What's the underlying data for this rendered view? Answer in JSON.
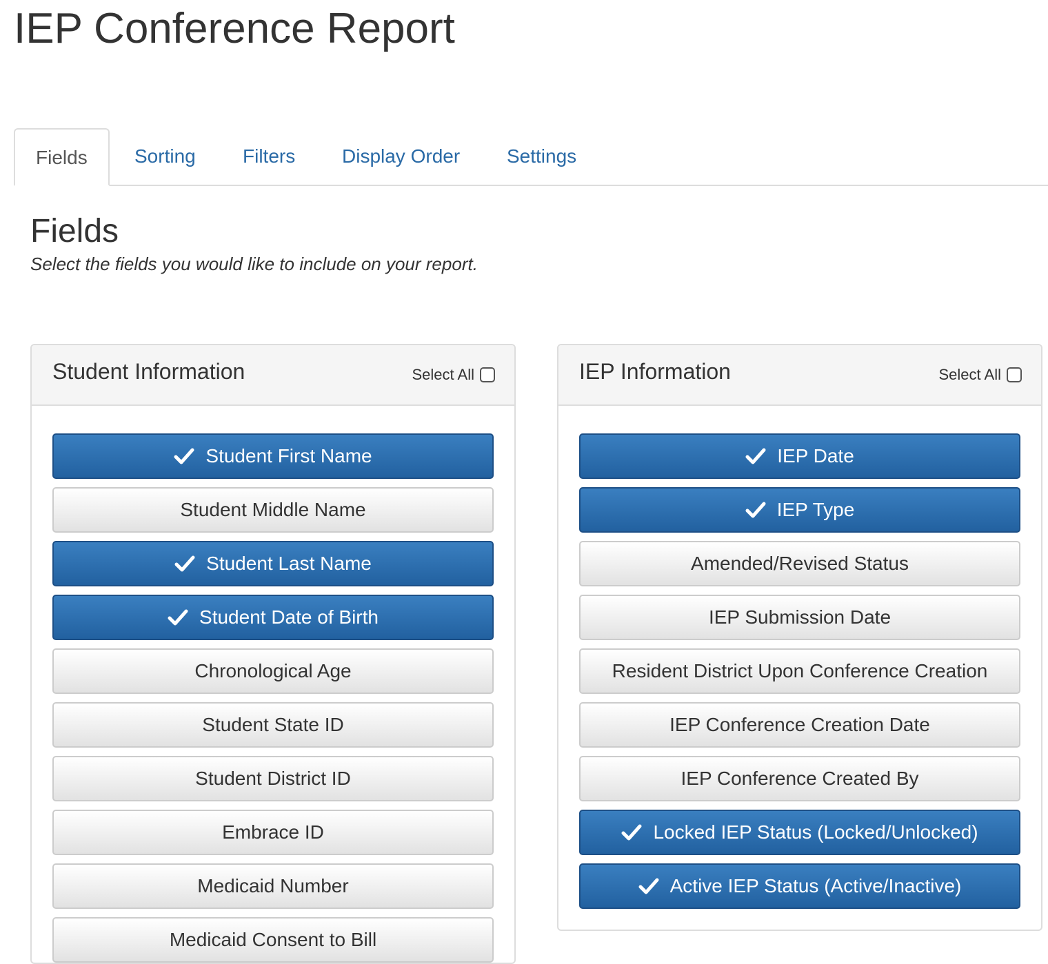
{
  "page": {
    "title": "IEP Conference Report"
  },
  "tabs": [
    {
      "label": "Fields",
      "active": true
    },
    {
      "label": "Sorting",
      "active": false
    },
    {
      "label": "Filters",
      "active": false
    },
    {
      "label": "Display Order",
      "active": false
    },
    {
      "label": "Settings",
      "active": false
    }
  ],
  "section": {
    "title": "Fields",
    "subtitle": "Select the fields you would like to include on your report."
  },
  "panels": {
    "student": {
      "title": "Student Information",
      "select_all_label": "Select All",
      "select_all_checked": false,
      "fields": [
        {
          "label": "Student First Name",
          "selected": true
        },
        {
          "label": "Student Middle Name",
          "selected": false
        },
        {
          "label": "Student Last Name",
          "selected": true
        },
        {
          "label": "Student Date of Birth",
          "selected": true
        },
        {
          "label": "Chronological Age",
          "selected": false
        },
        {
          "label": "Student State ID",
          "selected": false
        },
        {
          "label": "Student District ID",
          "selected": false
        },
        {
          "label": "Embrace ID",
          "selected": false
        },
        {
          "label": "Medicaid Number",
          "selected": false
        },
        {
          "label": "Medicaid Consent to Bill",
          "selected": false
        }
      ]
    },
    "iep": {
      "title": "IEP Information",
      "select_all_label": "Select All",
      "select_all_checked": false,
      "fields": [
        {
          "label": "IEP Date",
          "selected": true
        },
        {
          "label": "IEP Type",
          "selected": true
        },
        {
          "label": "Amended/Revised Status",
          "selected": false
        },
        {
          "label": "IEP Submission Date",
          "selected": false
        },
        {
          "label": "Resident District Upon Conference Creation",
          "selected": false
        },
        {
          "label": "IEP Conference Creation Date",
          "selected": false
        },
        {
          "label": "IEP Conference Created By",
          "selected": false
        },
        {
          "label": "Locked IEP Status (Locked/Unlocked)",
          "selected": true
        },
        {
          "label": "Active IEP Status (Active/Inactive)",
          "selected": true
        }
      ]
    }
  },
  "colors": {
    "selected_button": "#2a6aa6",
    "unselected_button": "#efefef",
    "tab_link": "#2a6aa6"
  },
  "icons": {
    "selected_marker": "check-icon"
  }
}
